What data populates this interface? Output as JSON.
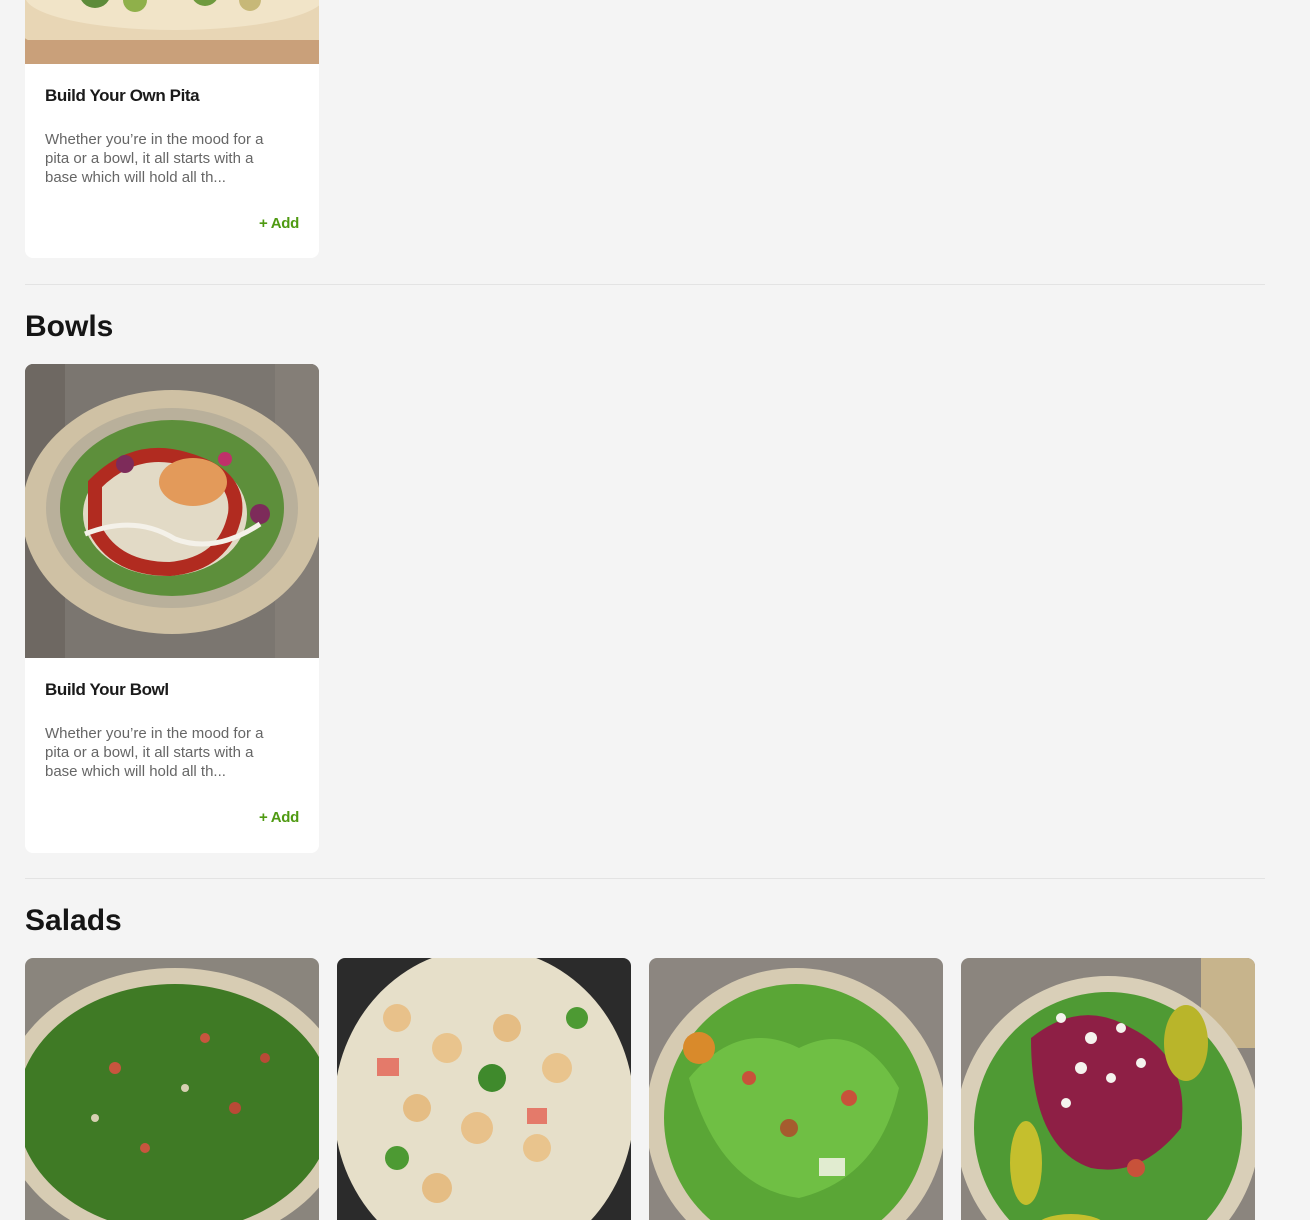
{
  "sections": {
    "pitas": {
      "items": [
        {
          "name": "Build Your Own Pita",
          "description": "Whether you’re in the mood for a pita or a bowl, it all starts with a base which will hold all th...",
          "add_label": "+ Add"
        }
      ]
    },
    "bowls": {
      "title": "Bowls",
      "items": [
        {
          "name": "Build Your Bowl",
          "description": "Whether you’re in the mood for a pita or a bowl, it all starts with a base which will hold all th...",
          "add_label": "+ Add"
        }
      ]
    },
    "salads": {
      "title": "Salads",
      "item_count_visible": 4
    }
  },
  "colors": {
    "background": "#f4f4f4",
    "card": "#ffffff",
    "add_accent": "#4f9a12",
    "title": "#151515",
    "description": "#666666"
  }
}
